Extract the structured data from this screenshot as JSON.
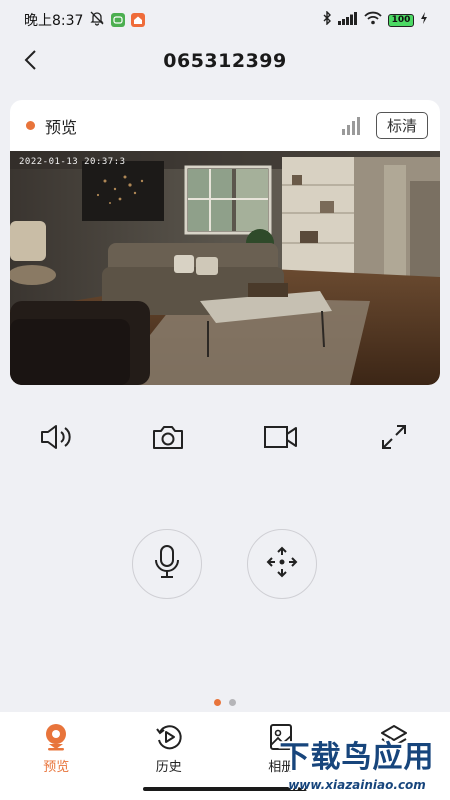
{
  "status_bar": {
    "time": "晚上8:37",
    "battery": "100"
  },
  "header": {
    "title": "065312399"
  },
  "camera": {
    "status_label": "预览",
    "quality_label": "标清",
    "timestamp": "2022-01-13 20:37:3",
    "status_color": "#e8743b"
  },
  "controls": [
    {
      "name": "speaker-icon"
    },
    {
      "name": "camera-icon"
    },
    {
      "name": "video-record-icon"
    },
    {
      "name": "fullscreen-icon"
    }
  ],
  "round_buttons": [
    {
      "name": "microphone-icon"
    },
    {
      "name": "ptz-direction-icon"
    }
  ],
  "pager": {
    "current": 1,
    "total": 2
  },
  "nav": {
    "items": [
      {
        "label": "预览",
        "active": true,
        "icon": "location-pin-icon"
      },
      {
        "label": "历史",
        "active": false,
        "icon": "history-play-icon"
      },
      {
        "label": "相册",
        "active": false,
        "icon": "album-icon"
      },
      {
        "label": "",
        "active": false,
        "icon": "layers-icon"
      }
    ]
  },
  "watermark": {
    "main": "下载鸟应用",
    "sub": "www.xiazainiao.com"
  },
  "colors": {
    "accent": "#e8743b",
    "background": "#eff0f4"
  }
}
